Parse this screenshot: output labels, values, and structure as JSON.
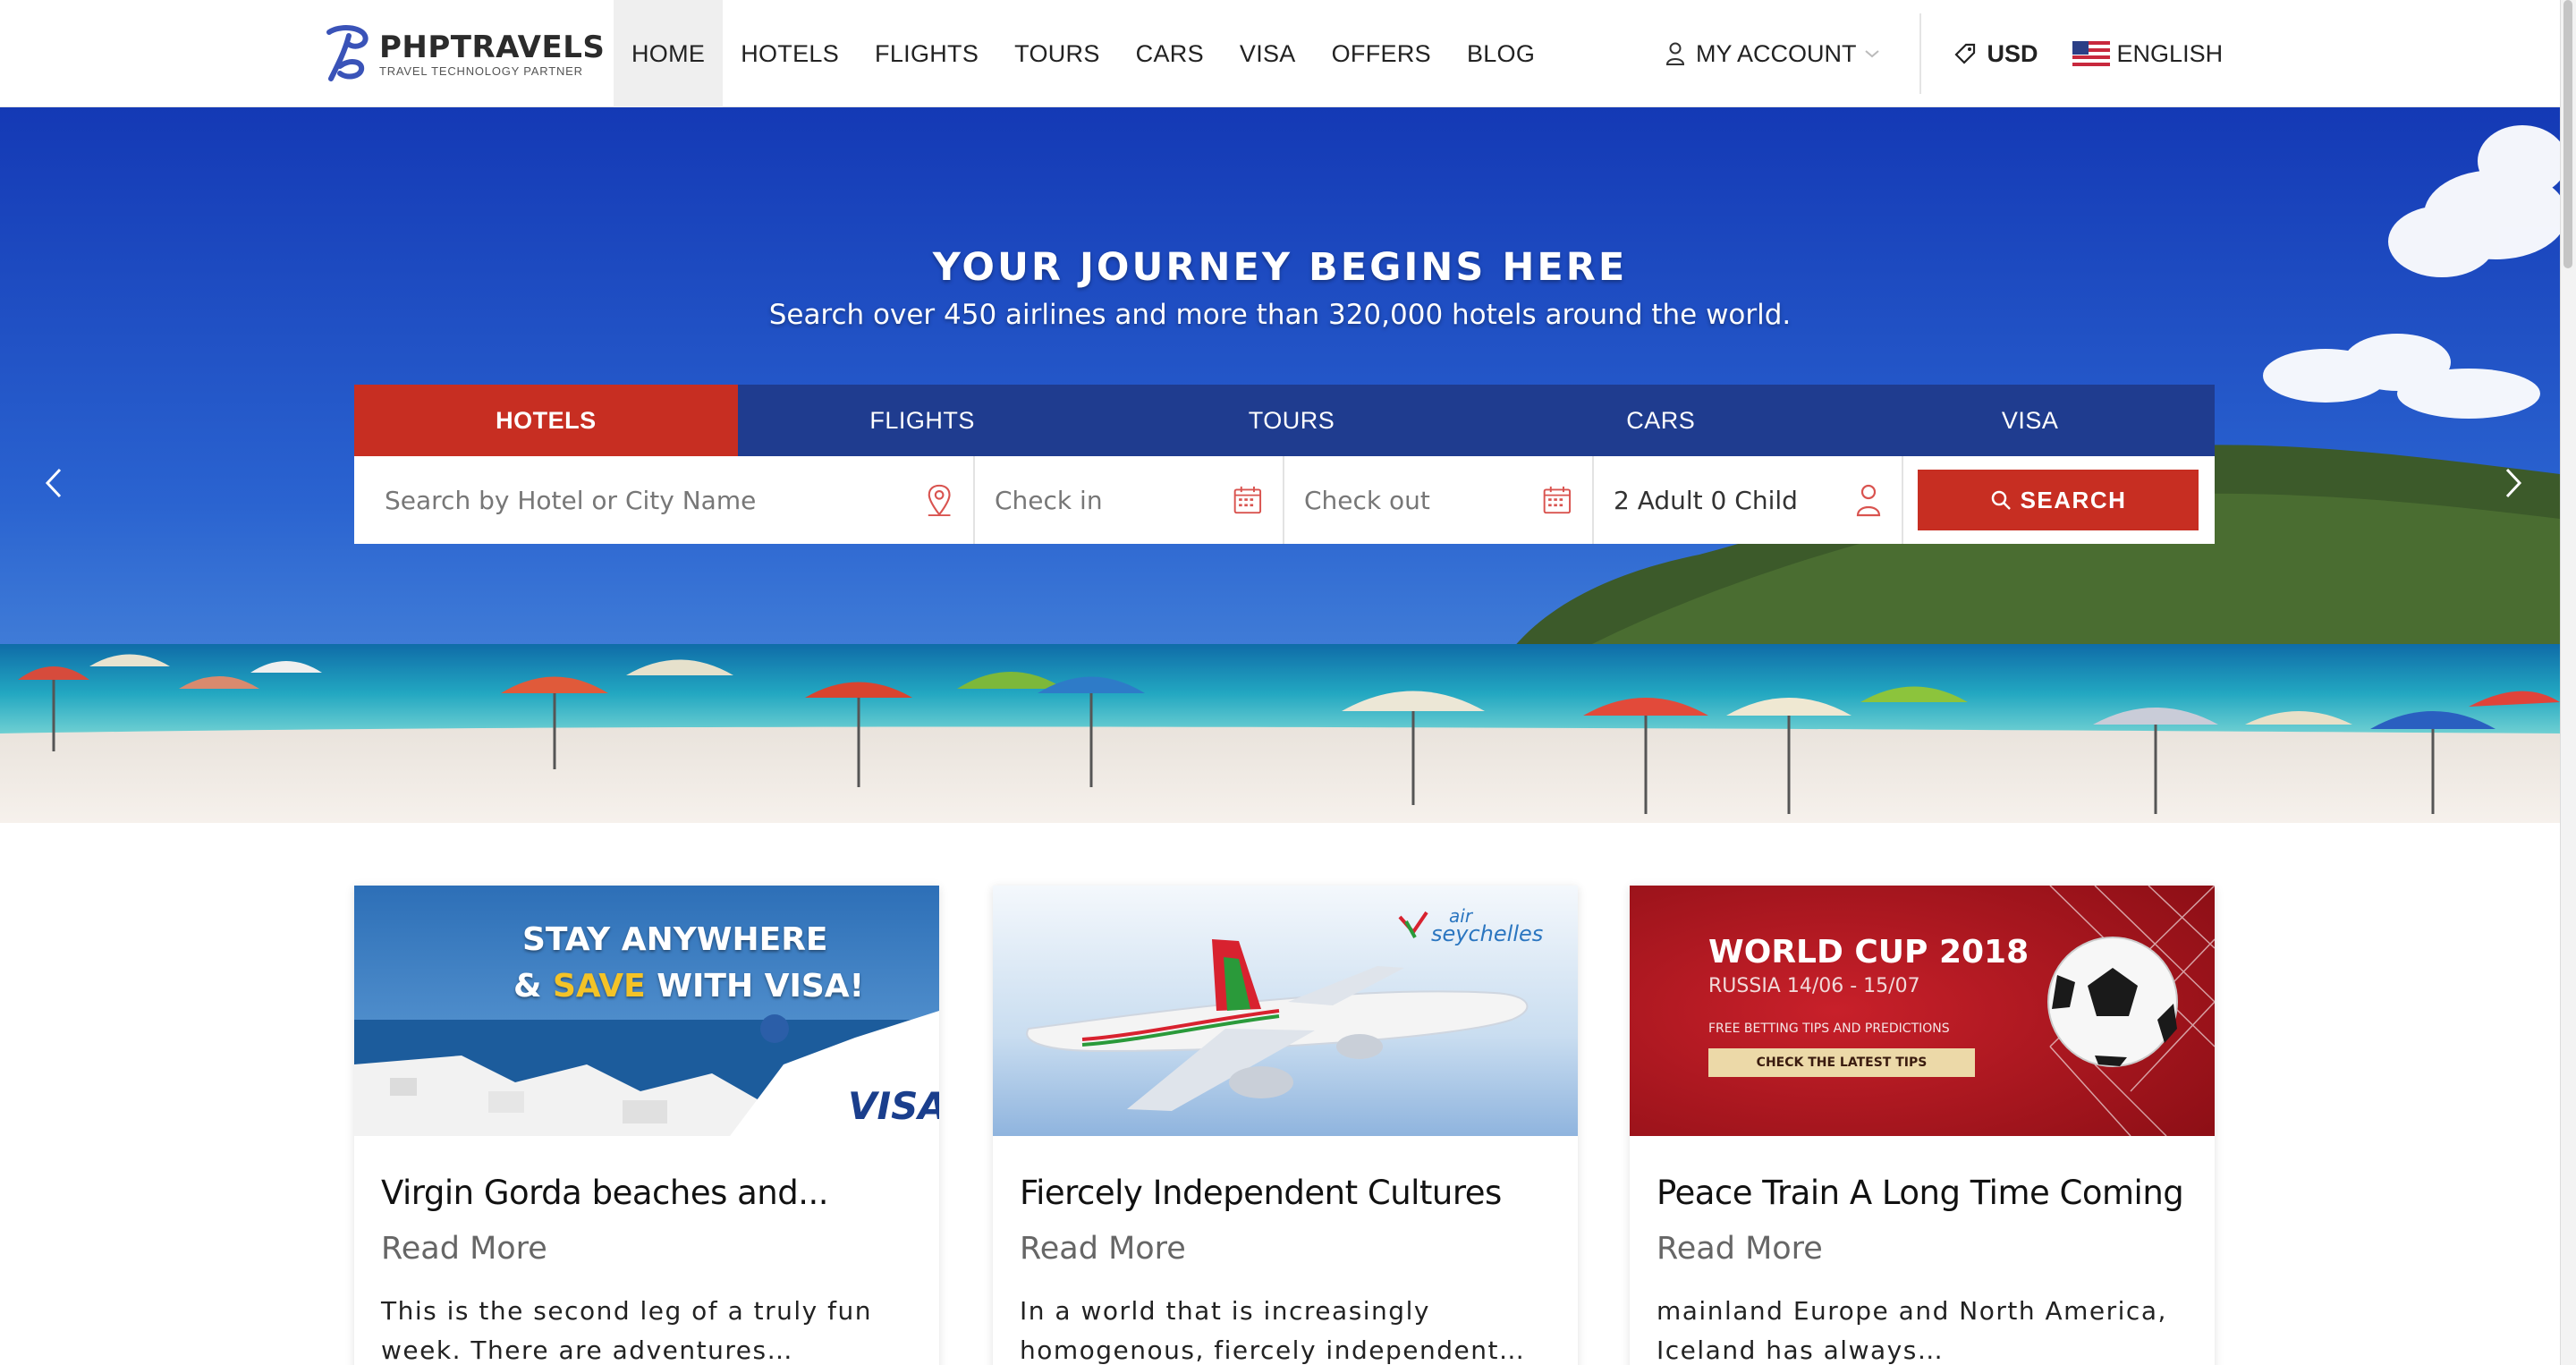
{
  "brand": {
    "name": "PHPTRAVELS",
    "tagline": "TRAVEL TECHNOLOGY PARTNER",
    "color": "#3a53b8"
  },
  "nav": {
    "items": [
      {
        "label": "HOME",
        "active": true
      },
      {
        "label": "HOTELS"
      },
      {
        "label": "FLIGHTS"
      },
      {
        "label": "TOURS"
      },
      {
        "label": "CARS"
      },
      {
        "label": "VISA"
      },
      {
        "label": "OFFERS"
      },
      {
        "label": "BLOG"
      }
    ],
    "account_label": "MY ACCOUNT",
    "currency": "USD",
    "language": "ENGLISH"
  },
  "hero": {
    "title": "YOUR JOURNEY BEGINS HERE",
    "subtitle": "Search over 450 airlines and more than 320,000 hotels around the world."
  },
  "search": {
    "tabs": [
      {
        "label": "HOTELS",
        "active": true
      },
      {
        "label": "FLIGHTS"
      },
      {
        "label": "TOURS"
      },
      {
        "label": "CARS"
      },
      {
        "label": "VISA"
      }
    ],
    "hotel_placeholder": "Search by Hotel or City Name",
    "checkin_placeholder": "Check in",
    "checkout_placeholder": "Check out",
    "guests": "2 Adult 0 Child",
    "button_label": "SEARCH"
  },
  "cards": [
    {
      "title": "Virgin Gorda beaches and...",
      "read_more": "Read More",
      "excerpt": "This is the second leg of a truly fun week. There are adventures…",
      "banner": {
        "line1": "STAY ANYWHERE",
        "line2a": "& ",
        "line2b": "SAVE",
        "line2c": " WITH VISA!",
        "badge": "VISA"
      }
    },
    {
      "title": "Fiercely Independent Cultures",
      "read_more": "Read More",
      "excerpt": "In a world that is increasingly homogenous, fiercely independent…",
      "banner": {
        "logo_top": "air",
        "logo_bottom": "seychelles"
      }
    },
    {
      "title": "Peace Train A Long Time Coming",
      "read_more": "Read More",
      "excerpt": " mainland Europe and North America, Iceland has always…",
      "banner": {
        "headline": "WORLD CUP 2018",
        "dates": "RUSSIA 14/06 - 15/07",
        "tips": "FREE BETTING TIPS AND PREDICTIONS",
        "cta": "CHECK THE LATEST TIPS"
      }
    }
  ],
  "colors": {
    "primary_red": "#c72e22",
    "nav_blue": "#1f3c8f"
  }
}
